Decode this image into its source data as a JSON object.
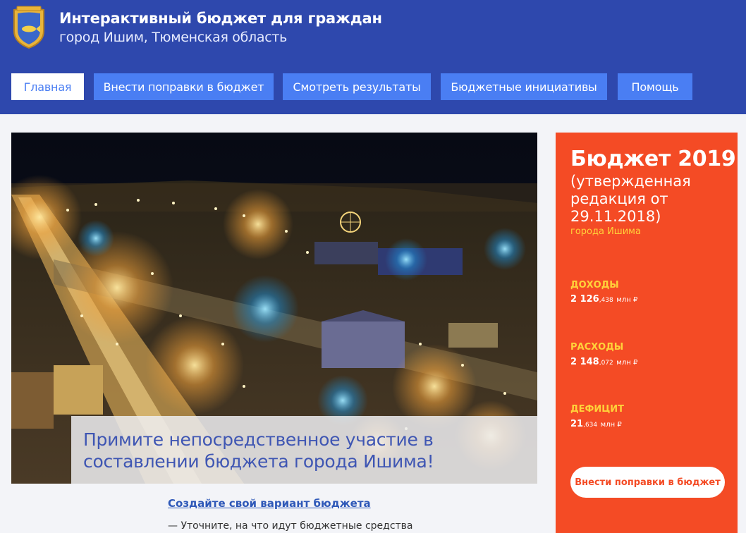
{
  "header": {
    "title": "Интерактивный бюджет для граждан",
    "subtitle": "город Ишим, Тюменская область",
    "logo_icon": "coat-of-arms-icon"
  },
  "nav": {
    "items": [
      {
        "label": "Главная",
        "active": true
      },
      {
        "label": "Внести поправки в бюджет",
        "active": false
      },
      {
        "label": "Смотреть результаты",
        "active": false
      },
      {
        "label": "Бюджетные инициативы",
        "active": false
      },
      {
        "label": "Помощь",
        "active": false
      }
    ]
  },
  "hero": {
    "caption": "Примите непосредственное участие в составлении бюджета города Ишима!"
  },
  "content": {
    "create_link": "Создайте свой вариант бюджета",
    "hint": "— Уточните, на что идут бюджетные средства"
  },
  "budget": {
    "title": "Бюджет 2019",
    "edition": "(утвержденная редакция от 29.11.2018)",
    "city": "города Ишима",
    "income": {
      "label": "ДОХОДЫ",
      "main": "2 126",
      "fraction": ",438",
      "unit": "млн ₽"
    },
    "expenses": {
      "label": "РАСХОДЫ",
      "main": "2 148",
      "fraction": ",072",
      "unit": "млн ₽"
    },
    "deficit": {
      "label": "ДЕФИЦИТ",
      "main": "21",
      "fraction": ",634",
      "unit": "млн ₽"
    },
    "button": "Внести поправки в бюджет"
  },
  "colors": {
    "header": "#2e48ad",
    "nav_button": "#4a7ef3",
    "budget_panel": "#f44b25",
    "accent_yellow": "#ffd23a"
  }
}
